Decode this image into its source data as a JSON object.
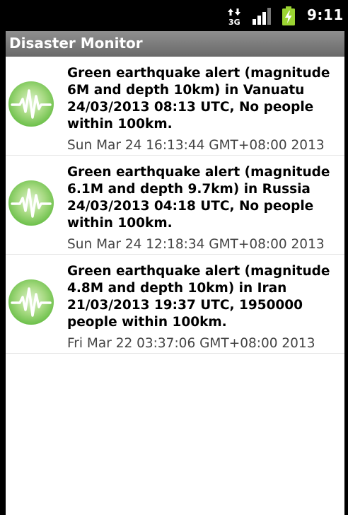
{
  "status_bar": {
    "network_label": "3G",
    "clock": "9:11",
    "icons": [
      "data-arrows-icon",
      "signal-icon",
      "battery-charging-icon"
    ]
  },
  "app": {
    "title": "Disaster Monitor"
  },
  "alerts": [
    {
      "headline": "Green earthquake alert (magnitude 6M and depth 10km) in Vanuatu 24/03/2013 08:13 UTC, No people within 100km.",
      "timestamp": "Sun Mar 24 16:13:44 GMT+08:00 2013",
      "icon": "seismic-wave-icon"
    },
    {
      "headline": "Green earthquake alert (magnitude 6.1M and depth 9.7km) in Russia 24/03/2013 04:18 UTC, No people within 100km.",
      "timestamp": "Sun Mar 24 12:18:34 GMT+08:00 2013",
      "icon": "seismic-wave-icon"
    },
    {
      "headline": "Green earthquake alert (magnitude 4.8M and depth 10km) in Iran 21/03/2013 19:37 UTC, 1950000 people within 100km.",
      "timestamp": "Fri Mar 22 03:37:06 GMT+08:00 2013",
      "icon": "seismic-wave-icon"
    }
  ],
  "colors": {
    "alert_green": "#6cc04a",
    "title_bar": "#7a7a7a"
  }
}
